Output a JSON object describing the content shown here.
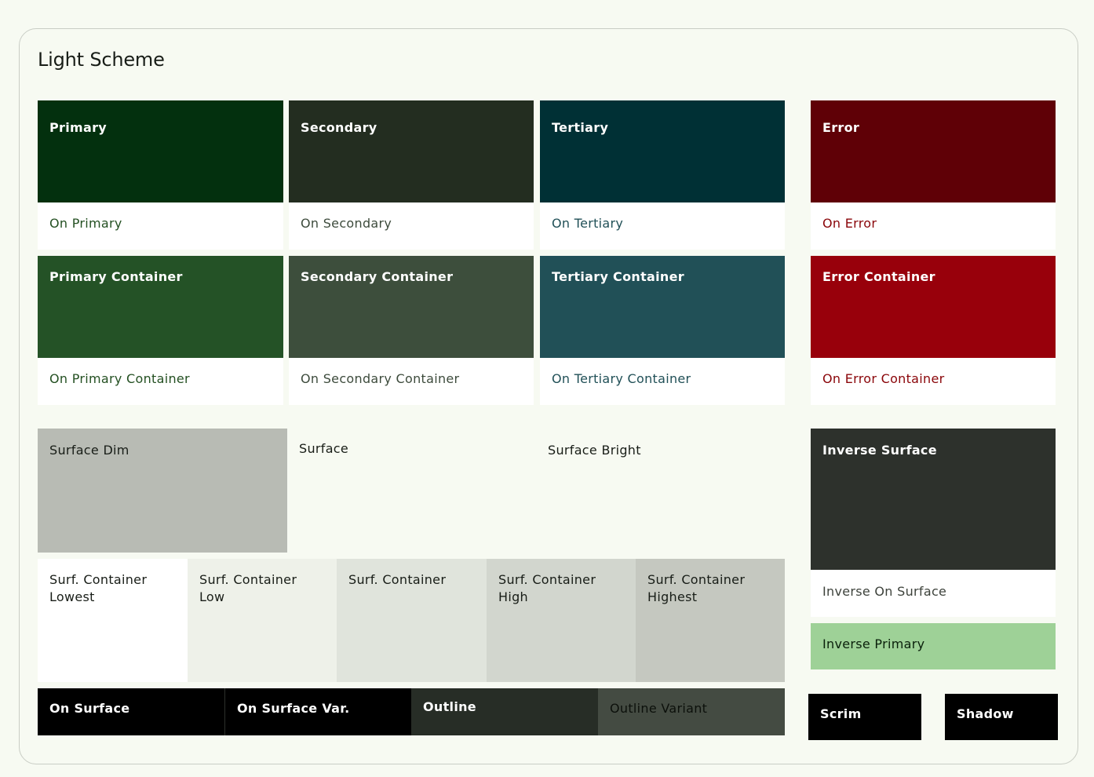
{
  "title": "Light Scheme",
  "colors": {
    "page_bg": "#f7faf2",
    "primary": "#03300e",
    "on_primary_text": "#245022",
    "secondary": "#232d20",
    "on_secondary_text": "#3d4b3c",
    "tertiary": "#003035",
    "on_tertiary_text": "#215057",
    "error": "#5f0006",
    "on_error_text": "#8a0509",
    "primary_container": "#245226",
    "secondary_container": "#3d4e3c",
    "tertiary_container": "#215057",
    "error_container": "#98000b",
    "surface_dim": "#b8bbb4",
    "surface": "#f7faf2",
    "surface_bright": "#f7faf2",
    "surf_container_lowest": "#ffffff",
    "surf_container_low": "#eef1e9",
    "surf_container": "#e0e4dc",
    "surf_container_high": "#d2d6ce",
    "surf_container_highest": "#c5c8c0",
    "on_surface": "#000000",
    "on_surface_var": "#000000",
    "outline": "#272d26",
    "outline_variant": "#444b42",
    "inverse_surface": "#2d312c",
    "inverse_on_surface": "#ffffff",
    "inverse_primary": "#9ed197",
    "scrim": "#000000",
    "shadow": "#000000"
  },
  "swatches": {
    "primary": "Primary",
    "on_primary": "On Primary",
    "secondary": "Secondary",
    "on_secondary": "On Secondary",
    "tertiary": "Tertiary",
    "on_tertiary": "On Tertiary",
    "error": "Error",
    "on_error": "On Error",
    "primary_container": "Primary Container",
    "on_primary_container": "On Primary Container",
    "secondary_container": "Secondary Container",
    "on_secondary_container": "On Secondary Container",
    "tertiary_container": "Tertiary Container",
    "on_tertiary_container": "On Tertiary Container",
    "error_container": "Error Container",
    "on_error_container": "On Error Container",
    "surface_dim": "Surface Dim",
    "surface": "Surface",
    "surface_bright": "Surface Bright",
    "surf_container_lowest": "Surf. Container Lowest",
    "surf_container_low": "Surf. Container Low",
    "surf_container": "Surf. Container",
    "surf_container_high": "Surf. Container High",
    "surf_container_highest": "Surf. Container Highest",
    "on_surface": "On Surface",
    "on_surface_var": "On Surface Var.",
    "outline": "Outline",
    "outline_variant": "Outline Variant",
    "inverse_surface": "Inverse Surface",
    "inverse_on_surface": "Inverse On Surface",
    "inverse_primary": "Inverse Primary",
    "scrim": "Scrim",
    "shadow": "Shadow"
  }
}
